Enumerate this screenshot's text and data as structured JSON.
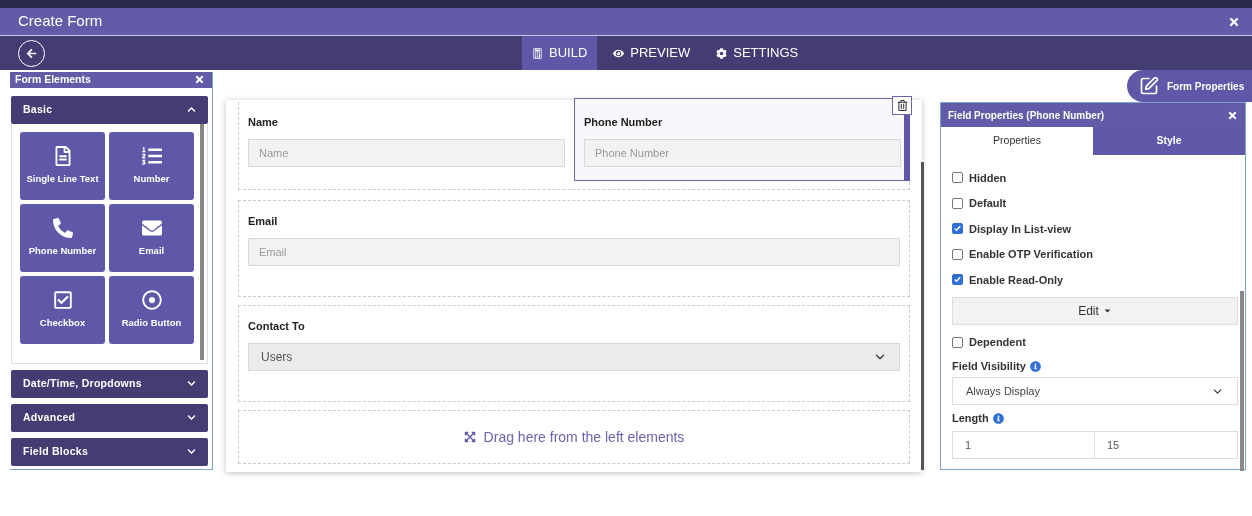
{
  "window": {
    "title": "Create Form"
  },
  "nav_tabs": [
    {
      "label": "BUILD",
      "kind": "build",
      "selected": true
    },
    {
      "label": "PREVIEW",
      "kind": "preview",
      "selected": false
    },
    {
      "label": "SETTINGS",
      "kind": "settings",
      "selected": false
    }
  ],
  "left_panel": {
    "title": "Form Elements",
    "sections": [
      {
        "label": "Basic",
        "expanded": true,
        "items": [
          {
            "label": "Single Line Text",
            "kind": "text"
          },
          {
            "label": "Number",
            "kind": "number"
          },
          {
            "label": "Phone Number",
            "kind": "phone"
          },
          {
            "label": "Email",
            "kind": "email"
          },
          {
            "label": "Checkbox",
            "kind": "checkbox"
          },
          {
            "label": "Radio Button",
            "kind": "radio"
          }
        ]
      },
      {
        "label": "Date/Time, Dropdowns",
        "expanded": false
      },
      {
        "label": "Advanced",
        "expanded": false
      },
      {
        "label": "Field Blocks",
        "expanded": false
      }
    ]
  },
  "form_properties_button": "Form Properties",
  "canvas": {
    "rows": [
      {
        "fields": [
          {
            "label": "Name",
            "placeholder": "Name",
            "kind": "input",
            "selected": false
          },
          {
            "label": "Phone Number",
            "placeholder": "Phone Number",
            "kind": "input",
            "selected": true
          }
        ]
      },
      {
        "fields": [
          {
            "label": "Email",
            "placeholder": "Email",
            "kind": "input",
            "selected": false
          }
        ]
      },
      {
        "fields": [
          {
            "label": "Contact To",
            "value": "Users",
            "kind": "select",
            "selected": false
          }
        ]
      }
    ],
    "drop_hint": "Drag here from the left elements"
  },
  "field_properties": {
    "title": "Field Properties (Phone Number)",
    "tabs": [
      {
        "label": "Properties",
        "selected": true
      },
      {
        "label": "Style",
        "selected": false
      }
    ],
    "options": [
      {
        "label": "Hidden",
        "checked": false
      },
      {
        "label": "Default",
        "checked": false
      },
      {
        "label": "Display In List-view",
        "checked": true
      },
      {
        "label": "Enable OTP Verification",
        "checked": false
      },
      {
        "label": "Enable Read-Only",
        "checked": true
      }
    ],
    "edit_button": "Edit",
    "dependent": {
      "label": "Dependent",
      "checked": false
    },
    "visibility": {
      "label": "Field Visibility",
      "value": "Always Display"
    },
    "length": {
      "label": "Length",
      "min": "1",
      "max": "15"
    }
  }
}
